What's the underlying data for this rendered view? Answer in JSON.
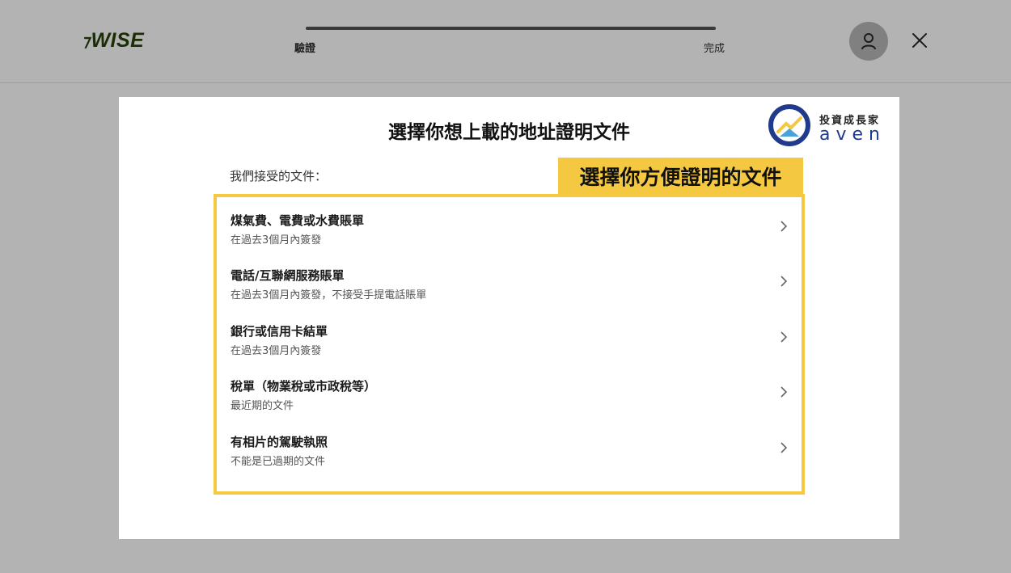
{
  "header": {
    "logo": "WISE",
    "logo_flag": "⁊",
    "steps": [
      "驗證",
      "完成"
    ],
    "progress_fraction": 1.0
  },
  "modal": {
    "title": "選擇你想上載的地址證明文件",
    "accepted_label": "我們接受的文件：",
    "highlight_text": "選擇你方便證明的文件",
    "brand_cn": "投資成長家",
    "brand_en": "aven",
    "items": [
      {
        "title": "煤氣費、電費或水費賬單",
        "subtitle": "在過去3個月內簽發"
      },
      {
        "title": "電話/互聯網服務賬單",
        "subtitle": "在過去3個月內簽發，不接受手提電話賬單"
      },
      {
        "title": "銀行或信用卡結單",
        "subtitle": "在過去3個月內簽發"
      },
      {
        "title": "稅單（物業稅或市政稅等）",
        "subtitle": "最近期的文件"
      },
      {
        "title": "有相片的駕駛執照",
        "subtitle": "不能是已過期的文件"
      }
    ]
  },
  "colors": {
    "highlight": "#f5c842",
    "brand_blue": "#203a8c",
    "logo_green": "#1a2e05"
  }
}
